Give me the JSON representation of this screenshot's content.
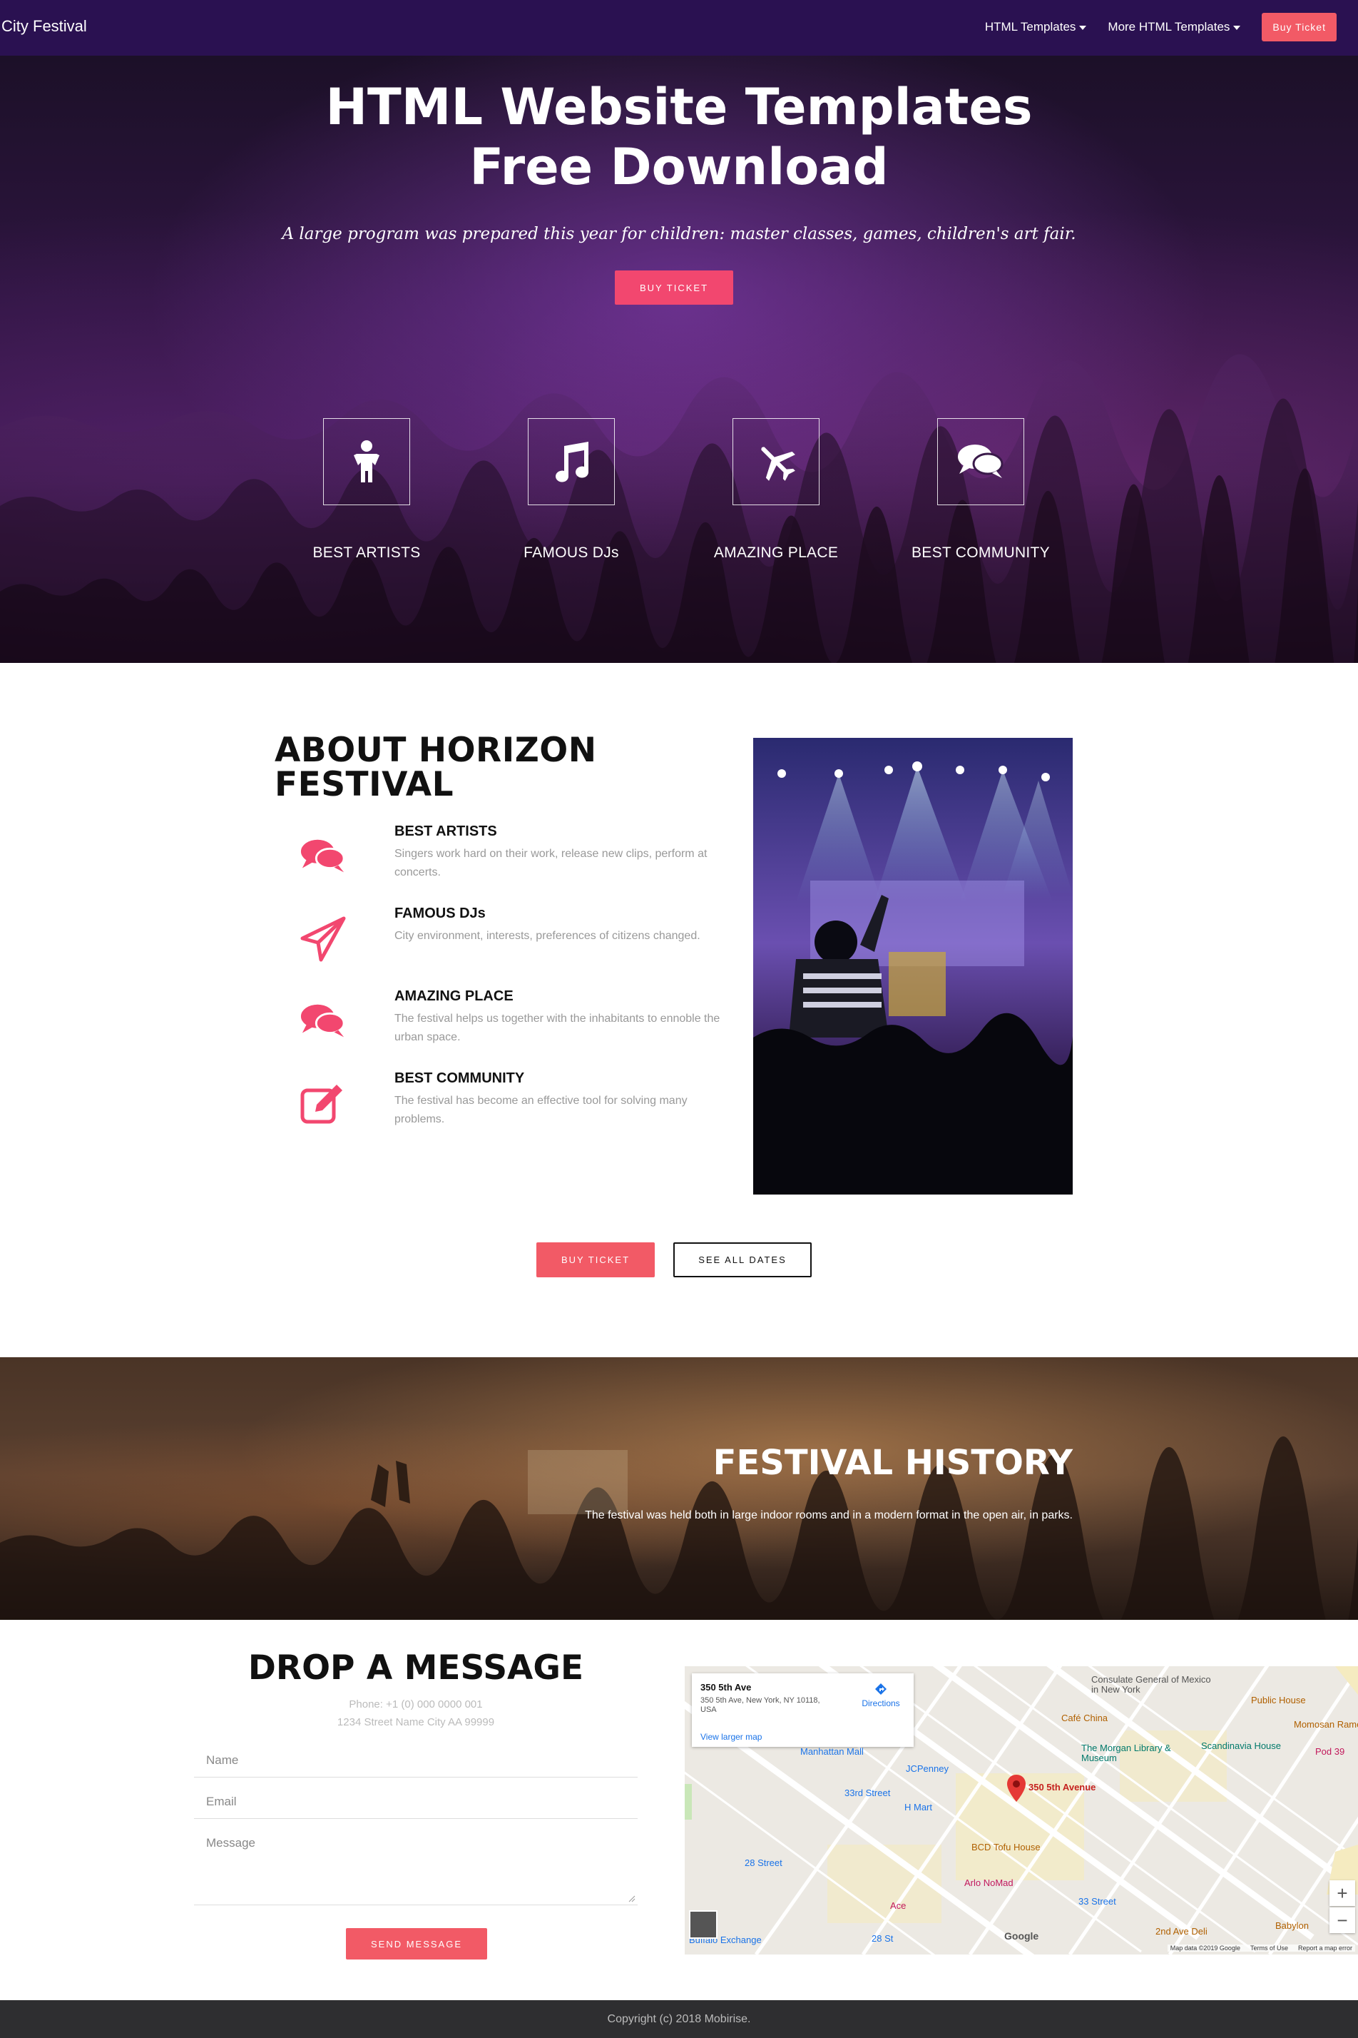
{
  "nav": {
    "brand": "City Festival",
    "links": [
      {
        "label": "HTML Templates"
      },
      {
        "label": "More HTML Templates"
      }
    ],
    "cta": "Buy Ticket"
  },
  "hero": {
    "title_line1": "HTML Website Templates",
    "title_line2": "Free Download",
    "subtitle": "A large program was prepared this year for children: master classes, games, children's art fair.",
    "button": "BUY TICKET",
    "features": [
      {
        "label": "BEST ARTISTS",
        "icon": "child-icon"
      },
      {
        "label": "FAMOUS DJs",
        "icon": "music-note-icon"
      },
      {
        "label": "AMAZING PLACE",
        "icon": "airplane-icon"
      },
      {
        "label": "BEST COMMUNITY",
        "icon": "chat-bubbles-icon"
      }
    ]
  },
  "about": {
    "title_line1": "ABOUT HORIZON",
    "title_line2": "FESTIVAL",
    "items": [
      {
        "title": "BEST ARTISTS",
        "text": "Singers work hard on their work, release new clips, perform at concerts.",
        "icon": "chat-bubbles-icon"
      },
      {
        "title": "FAMOUS DJs",
        "text": "City environment, interests, preferences of citizens changed.",
        "icon": "paper-plane-icon"
      },
      {
        "title": "AMAZING PLACE",
        "text": "The festival helps us together with the inhabitants to ennoble the urban space.",
        "icon": "chat-bubbles-icon"
      },
      {
        "title": "BEST COMMUNITY",
        "text": "The festival has become an effective tool for solving many problems.",
        "icon": "edit-icon"
      }
    ],
    "buy_button": "BUY TICKET",
    "dates_button": "SEE ALL DATES",
    "accent_color": "#f2476f"
  },
  "history": {
    "title": "FESTIVAL HISTORY",
    "text": "The festival was held both in large indoor rooms and in a modern format in the open air, in parks."
  },
  "contact": {
    "title": "DROP A MESSAGE",
    "phone": "Phone: +1 (0) 000 0000 001",
    "address": "1234 Street Name City AA 99999",
    "name_placeholder": "Name",
    "email_placeholder": "Email",
    "message_placeholder": "Message",
    "send_button": "SEND MESSAGE"
  },
  "map": {
    "card_title": "350 5th Ave",
    "card_address": "350 5th Ave, New York, NY 10118, USA",
    "directions": "Directions",
    "larger_map": "View larger map",
    "pin_label": "350 5th Avenue",
    "places": [
      "Consulate General of Mexico in New York",
      "Public House",
      "Café China",
      "Scandinavia House",
      "The Morgan Library & Museum",
      "Manhattan Mall",
      "JCPenney",
      "33rd Street",
      "H Mart",
      "BCD Tofu House",
      "Arlo NoMad",
      "33 Street",
      "28 Street",
      "28 St",
      "Buffalo Exchange",
      "2nd Ave Deli",
      "Babylon",
      "Momosan Ramen",
      "Pod 39",
      "Ace"
    ],
    "footer_text": [
      "Map data ©2019 Google",
      "Terms of Use",
      "Report a map error"
    ],
    "logo": "Google"
  },
  "footer": {
    "copyright": "Copyright (c) 2018 Mobirise."
  }
}
